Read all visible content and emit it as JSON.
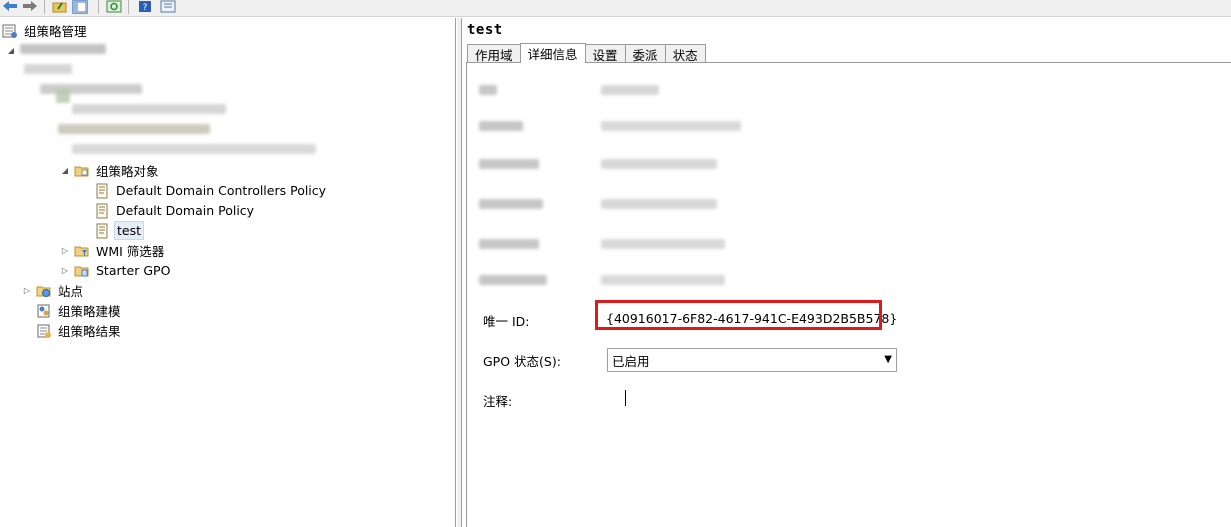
{
  "tree": {
    "root": {
      "label": "组策略管理"
    },
    "gpo_folder": {
      "label": "组策略对象"
    },
    "gpos": [
      {
        "label": "Default Domain Controllers Policy"
      },
      {
        "label": "Default Domain Policy"
      },
      {
        "label": "test"
      }
    ],
    "wmi": {
      "label": "WMI 筛选器"
    },
    "starter": {
      "label": "Starter GPO"
    },
    "sites": {
      "label": "站点"
    },
    "modeling": {
      "label": "组策略建模"
    },
    "results": {
      "label": "组策略结果"
    }
  },
  "details": {
    "title": "test",
    "tabs": [
      "作用域",
      "详细信息",
      "设置",
      "委派",
      "状态"
    ],
    "active_tab": "详细信息",
    "unique_id_label": "唯一 ID:",
    "unique_id_value": "{40916017-6F82-4617-941C-E493D2B5B578}",
    "gpo_status_label": "GPO 状态(S):",
    "gpo_status_value": "已启用",
    "comment_label": "注释:"
  },
  "colors": {
    "highlight_border": "#e0191b",
    "selection_bg": "#e5eef8"
  }
}
